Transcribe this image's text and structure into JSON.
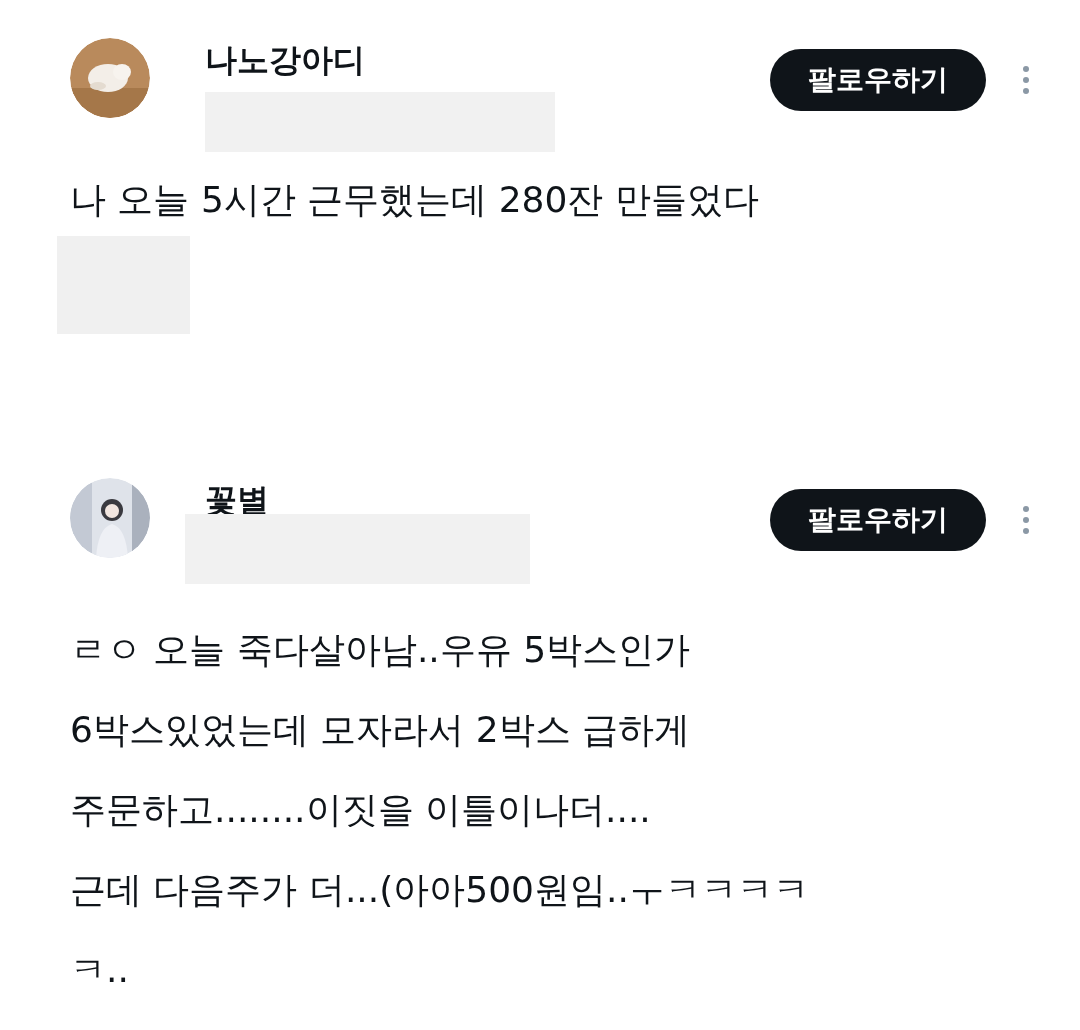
{
  "posts": [
    {
      "username": "나노강아디",
      "follow_button": "팔로우하기",
      "body": "나 오늘 5시간 근무했는데 280잔 만들었다",
      "attachment": {
        "kind": "redacted"
      }
    },
    {
      "username": "꽃별",
      "follow_button": "팔로우하기",
      "body": "ㄹㅇ 오늘 죽다살아남..우유 5박스인가\n6박스있었는데 모자라서 2박스 급하게\n주문하고........이짓을 이틀이나더....\n근데 다음주가 더...(아아500원임..ㅜㅋㅋㅋㅋㅋ.."
    }
  ]
}
